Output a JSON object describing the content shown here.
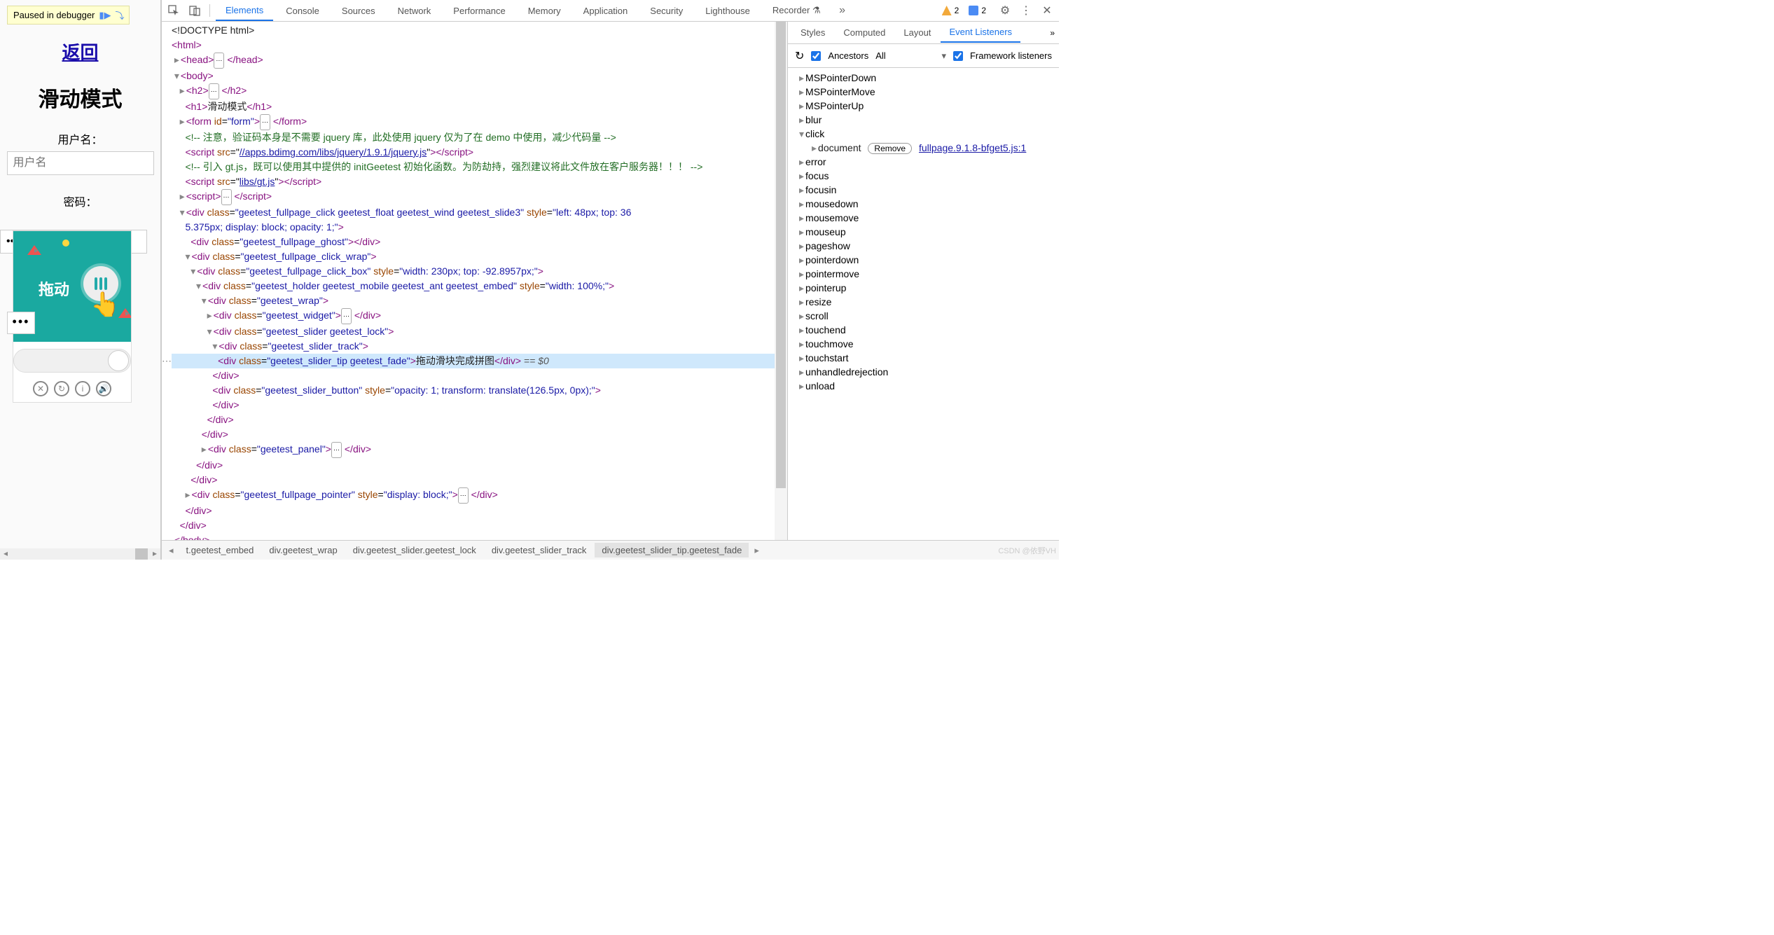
{
  "page": {
    "paused": "Paused in debugger",
    "back": "返回",
    "mode": "滑动模式",
    "user_label": "用户名：",
    "user_ph": "用户名",
    "pw_label": "密码：",
    "pw_val": "••••••",
    "widget_text": "拖动",
    "dots": "•••"
  },
  "devtools": {
    "tabs": [
      "Elements",
      "Console",
      "Sources",
      "Network",
      "Performance",
      "Memory",
      "Application",
      "Security",
      "Lighthouse",
      "Recorder"
    ],
    "active": "Elements",
    "warn": "2",
    "info": "2"
  },
  "dom": {
    "doctype": "<!DOCTYPE html>",
    "h1": "滑动模式",
    "cm1": "<!-- 注意，验证码本身是不需要 jquery 库，此处使用 jquery 仅为了在 demo 中使用，减少代码量 -->",
    "jq": "//apps.bdimg.com/libs/jquery/1.9.1/jquery.js",
    "cm2": "<!-- 引入 gt.js，既可以使用其中提供的 initGeetest 初始化函数。为防劫持，强烈建议将此文件放在客户服务器！！！ -->",
    "gt": "libs/gt.js",
    "slider_tip": "拖动滑块完成拼图",
    "eq": " == $0"
  },
  "right": {
    "tabs": [
      "Styles",
      "Computed",
      "Layout",
      "Event Listeners"
    ],
    "active": "Event Listeners",
    "ancestors": "Ancestors",
    "all": "All",
    "fw": "Framework listeners",
    "events": [
      "MSPointerDown",
      "MSPointerMove",
      "MSPointerUp",
      "blur",
      "click",
      "error",
      "focus",
      "focusin",
      "mousedown",
      "mousemove",
      "mouseup",
      "pageshow",
      "pointerdown",
      "pointermove",
      "pointerup",
      "resize",
      "scroll",
      "touchend",
      "touchmove",
      "touchstart",
      "unhandledrejection",
      "unload"
    ],
    "open": "click",
    "doc": "document",
    "remove": "Remove",
    "loc": "fullpage.9.1.8-bfget5.js:1"
  },
  "crumbs": [
    "t.geetest_embed",
    "div.geetest_wrap",
    "div.geetest_slider.geetest_lock",
    "div.geetest_slider_track",
    "div.geetest_slider_tip.geetest_fade"
  ],
  "watermark": "CSDN @依野VH"
}
